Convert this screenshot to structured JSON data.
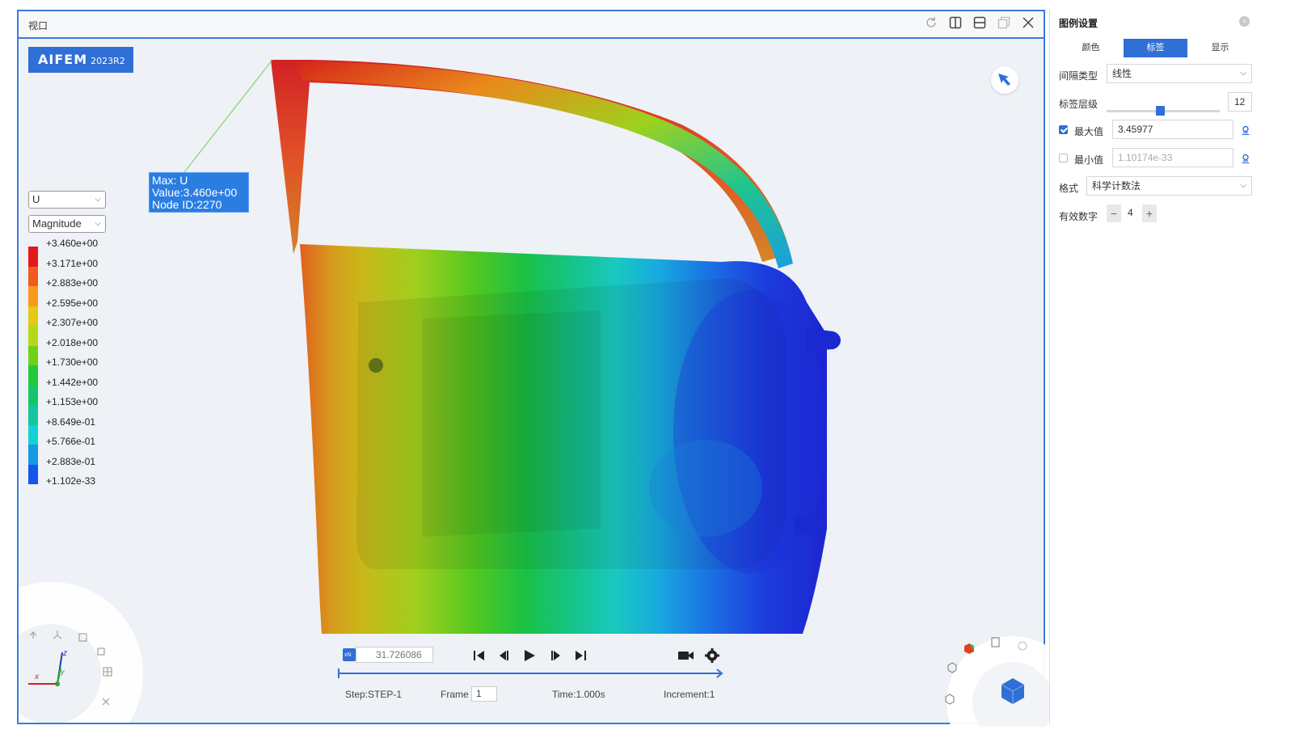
{
  "viewport": {
    "title": "视口",
    "controls": [
      "refresh-icon",
      "split-vertical-icon",
      "split-horizontal-icon",
      "restore-icon",
      "close-icon"
    ]
  },
  "logo": {
    "brand": "AIFEM",
    "version": "2023R2"
  },
  "result_selectors": {
    "variable": "U",
    "component": "Magnitude"
  },
  "legend": {
    "labels": [
      "+3.460e+00",
      "+3.171e+00",
      "+2.883e+00",
      "+2.595e+00",
      "+2.307e+00",
      "+2.018e+00",
      "+1.730e+00",
      "+1.442e+00",
      "+1.153e+00",
      "+8.649e-01",
      "+5.766e-01",
      "+2.883e-01",
      "+1.102e-33"
    ],
    "colors": [
      "#e31a1c",
      "#f4591d",
      "#f99a1a",
      "#e7c815",
      "#b6d81a",
      "#6fd11a",
      "#22c93a",
      "#15c569",
      "#13c6a0",
      "#12d2d4",
      "#1499e6",
      "#1457ea",
      "#1414e0"
    ]
  },
  "probe": {
    "line1": "Max: U",
    "line2": "Value:3.460e+00",
    "line3": "Node ID:2270"
  },
  "playback": {
    "frame_value": "31.726086",
    "step_label": "Step:STEP-1",
    "frame_label": "Frame",
    "frame_number": "1",
    "time_label": "Time:1.000s",
    "increment_label": "Increment:1",
    "buttons": [
      "skip-start-icon",
      "step-back-icon",
      "play-icon",
      "step-forward-icon",
      "skip-end-icon",
      "record-camera-icon",
      "settings-gear-icon"
    ]
  },
  "panel": {
    "title": "图例设置",
    "tabs": [
      {
        "label": "颜色",
        "active": false
      },
      {
        "label": "标签",
        "active": true
      },
      {
        "label": "显示",
        "active": false
      }
    ],
    "interval_type_label": "间隔类型",
    "interval_type_value": "线性",
    "label_levels_label": "标签层级",
    "label_levels_value": "12",
    "label_levels_fraction": 0.47,
    "max_label": "最大值",
    "max_checked": true,
    "max_value": "3.45977",
    "min_label": "最小值",
    "min_checked": false,
    "min_value": "1.10174e-33",
    "format_label": "格式",
    "format_value": "科学计数法",
    "sig_digits_label": "有效数字",
    "sig_digits_value": "4",
    "minus": "−",
    "plus": "+"
  }
}
